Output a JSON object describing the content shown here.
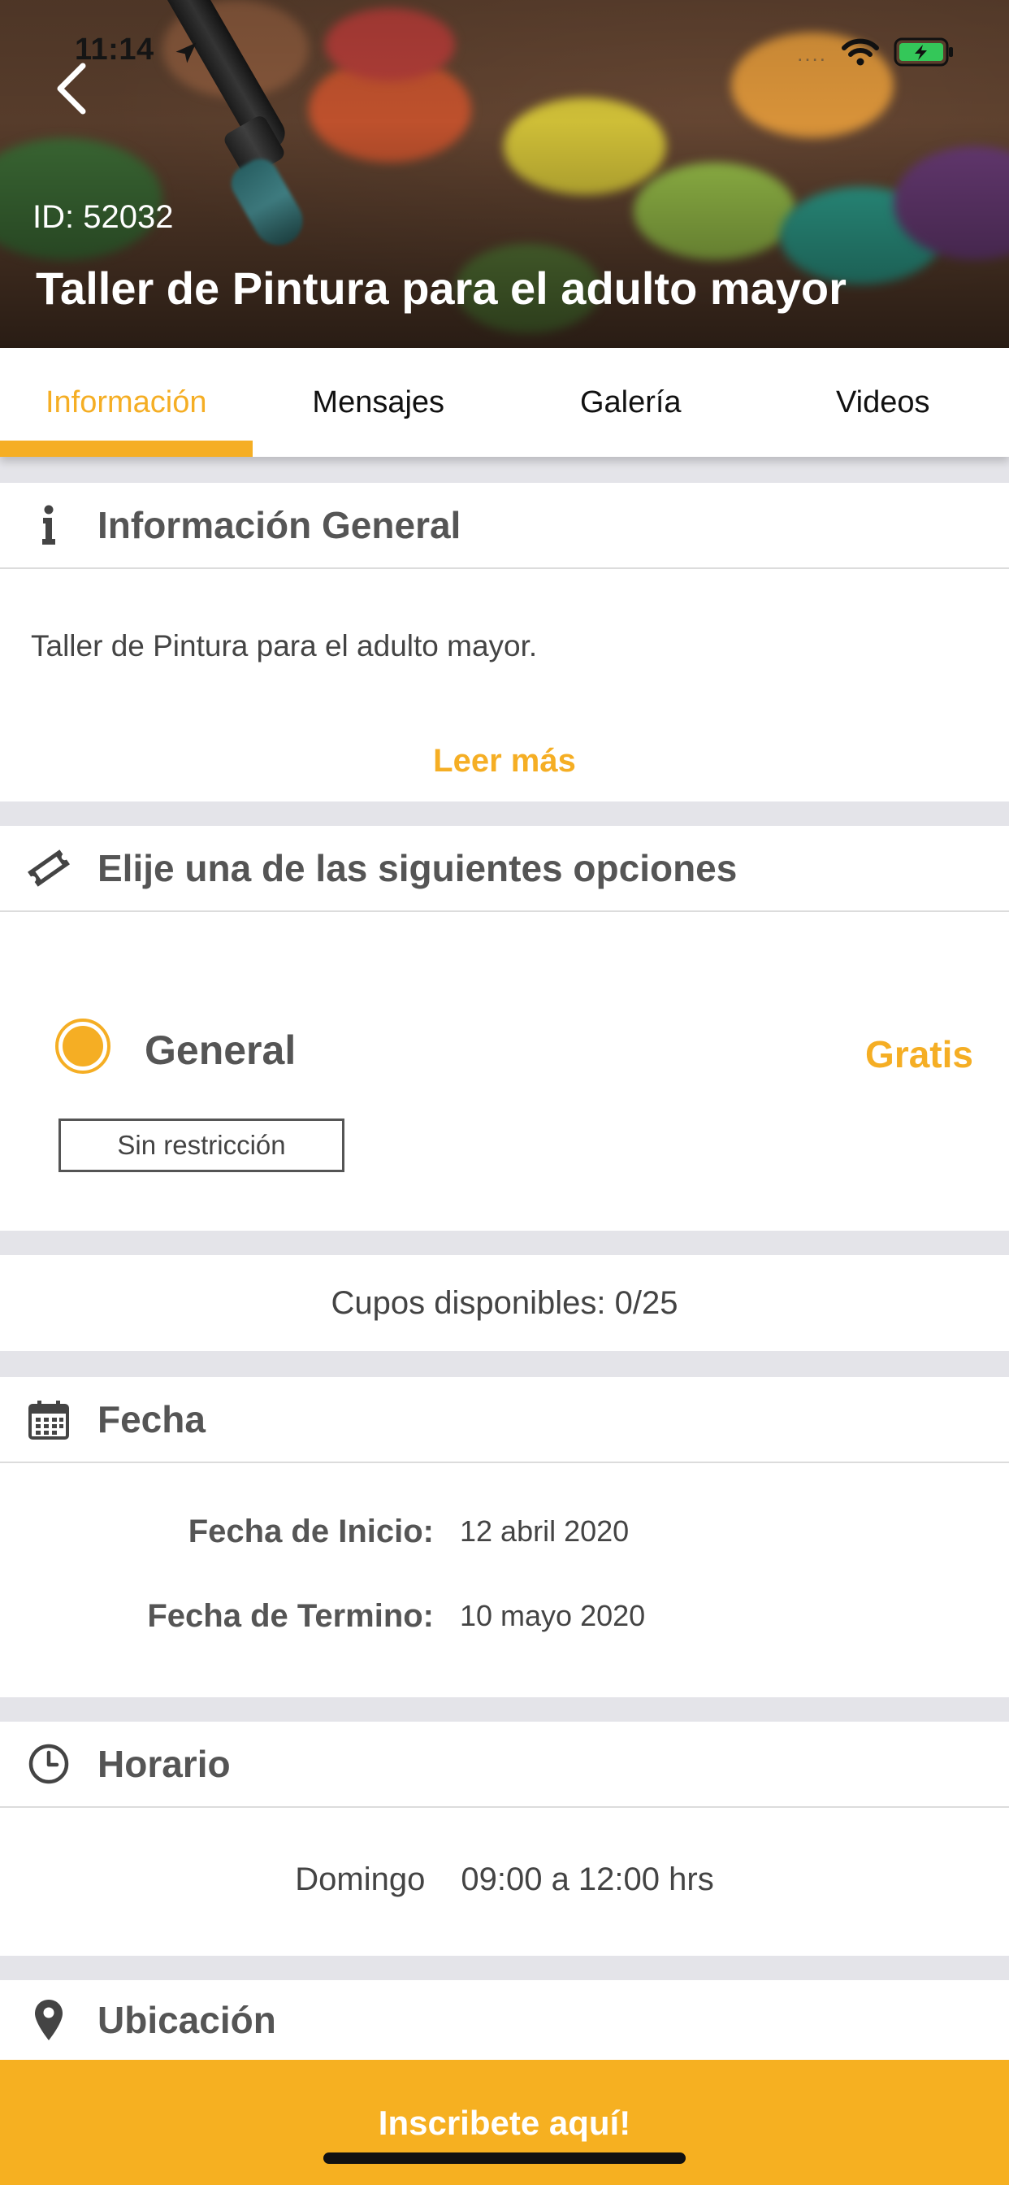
{
  "status_bar": {
    "time": "11:14",
    "signal": "....",
    "colors": {
      "battery": "#34c759"
    }
  },
  "header": {
    "id_text": "ID: 52032",
    "title": "Taller de Pintura para el adulto mayor"
  },
  "tabs": [
    {
      "label": "Información",
      "active": true
    },
    {
      "label": "Mensajes",
      "active": false
    },
    {
      "label": "Galería",
      "active": false
    },
    {
      "label": "Videos",
      "active": false
    }
  ],
  "info": {
    "title": "Información General",
    "description": "Taller de Pintura para el adulto mayor.",
    "read_more": "Leer más"
  },
  "options": {
    "title": "Elije una de las siguientes opciones",
    "items": [
      {
        "name": "General",
        "price": "Gratis",
        "restriction": "Sin restricción",
        "selected": true
      }
    ]
  },
  "availability": {
    "text": "Cupos disponibles: 0/25"
  },
  "dates": {
    "title": "Fecha",
    "start_label": "Fecha de Inicio:",
    "start_value": "12 abril 2020",
    "end_label": "Fecha de Termino:",
    "end_value": "10 mayo 2020"
  },
  "schedule": {
    "title": "Horario",
    "day": "Domingo",
    "hours": "09:00 a 12:00 hrs"
  },
  "location": {
    "title": "Ubicación"
  },
  "cta": {
    "label": "Inscribete aquí!"
  },
  "colors": {
    "accent": "#f5ae24",
    "cta_bg": "#f6b021",
    "section_bg": "#e4e4e9"
  },
  "icons": [
    "back-chevron-icon",
    "info-icon",
    "ticket-icon",
    "calendar-icon",
    "clock-icon",
    "location-pin-icon",
    "wifi-icon",
    "battery-icon",
    "location-arrow-icon"
  ]
}
